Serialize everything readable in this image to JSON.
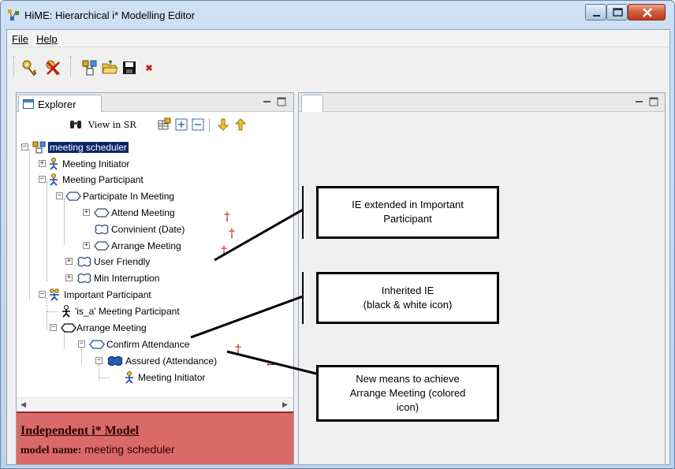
{
  "window": {
    "title": "HiME: Hierarchical i* Modelling Editor",
    "controls": [
      "minimize-icon",
      "maximize-icon",
      "close-icon"
    ]
  },
  "menu": {
    "file": "File",
    "help": "Help"
  },
  "toolbar": {
    "icons": [
      "key-icon",
      "key-remove-icon",
      "new-model-icon",
      "open-folder-icon",
      "save-icon",
      "close-red-x-icon"
    ]
  },
  "explorer": {
    "tab_label": "Explorer",
    "view_in_sr": "View in SR",
    "tree": [
      {
        "label": "meeting scheduler",
        "selected": true
      },
      {
        "label": "Meeting Initiator"
      },
      {
        "label": "Meeting Participant"
      },
      {
        "label": "Participate In Meeting"
      },
      {
        "label": "Attend Meeting"
      },
      {
        "label": "Convinient (Date)"
      },
      {
        "label": "Arrange Meeting"
      },
      {
        "label": "User Friendly"
      },
      {
        "label": "Min Interruption"
      },
      {
        "label": "Important Participant"
      },
      {
        "label": "'is_a' Meeting Participant"
      },
      {
        "label": "Arrange Meeting"
      },
      {
        "label": "Confirm Attendance"
      },
      {
        "label": "Assured (Attendance)"
      },
      {
        "label": "Meeting Initiator"
      }
    ]
  },
  "status": {
    "title": "Independent i* Model",
    "model_name_key": "model  name:",
    "model_name_value": "meeting scheduler"
  },
  "callouts": {
    "c1": [
      "IE extended in Important",
      "Participant"
    ],
    "c2": [
      "Inherited IE",
      "(black & white  icon)"
    ],
    "c3": [
      "New means  to achieve",
      "Arrange Meeting (colored",
      "icon)"
    ]
  },
  "colors": {
    "status_bg": "#d96a67",
    "selection": "#0a246a",
    "dagger": "#b31b1b"
  }
}
